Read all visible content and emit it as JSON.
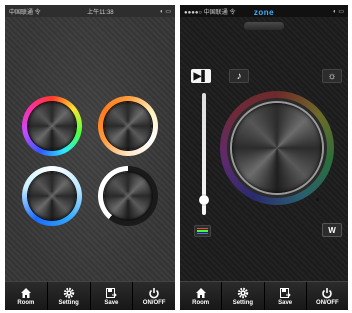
{
  "left_screen": {
    "status": {
      "carrier": "中国联通 令",
      "time": "上午11:38",
      "right": "◐ ▭"
    },
    "knobs": [
      {
        "name": "rgb-color-knob"
      },
      {
        "name": "warm-white-knob"
      },
      {
        "name": "cool-white-knob"
      },
      {
        "name": "dimmer-knob"
      }
    ],
    "tabs": [
      {
        "label": "Room",
        "icon": "home-icon"
      },
      {
        "label": "Setting",
        "icon": "gear-icon"
      },
      {
        "label": "Save",
        "icon": "save-icon"
      },
      {
        "label": "ON/OFF",
        "icon": "power-icon"
      }
    ]
  },
  "right_screen": {
    "status": {
      "carrier": "●●●●○ 中国联通 令",
      "time": "",
      "right": "◐ ▭"
    },
    "title": "zone",
    "buttons": {
      "play_label": "▶▌",
      "music_label": "♪",
      "brightness_label": "☼",
      "white_label": "W"
    },
    "tabs": [
      {
        "label": "Room",
        "icon": "home-icon"
      },
      {
        "label": "Setting",
        "icon": "gear-icon"
      },
      {
        "label": "Save",
        "icon": "save-icon"
      },
      {
        "label": "ON/OFF",
        "icon": "power-icon"
      }
    ]
  },
  "colors": {
    "accent_blue": "#3fb0ff",
    "background_left": "#3a3a3a",
    "background_right": "#1e1e1e"
  }
}
